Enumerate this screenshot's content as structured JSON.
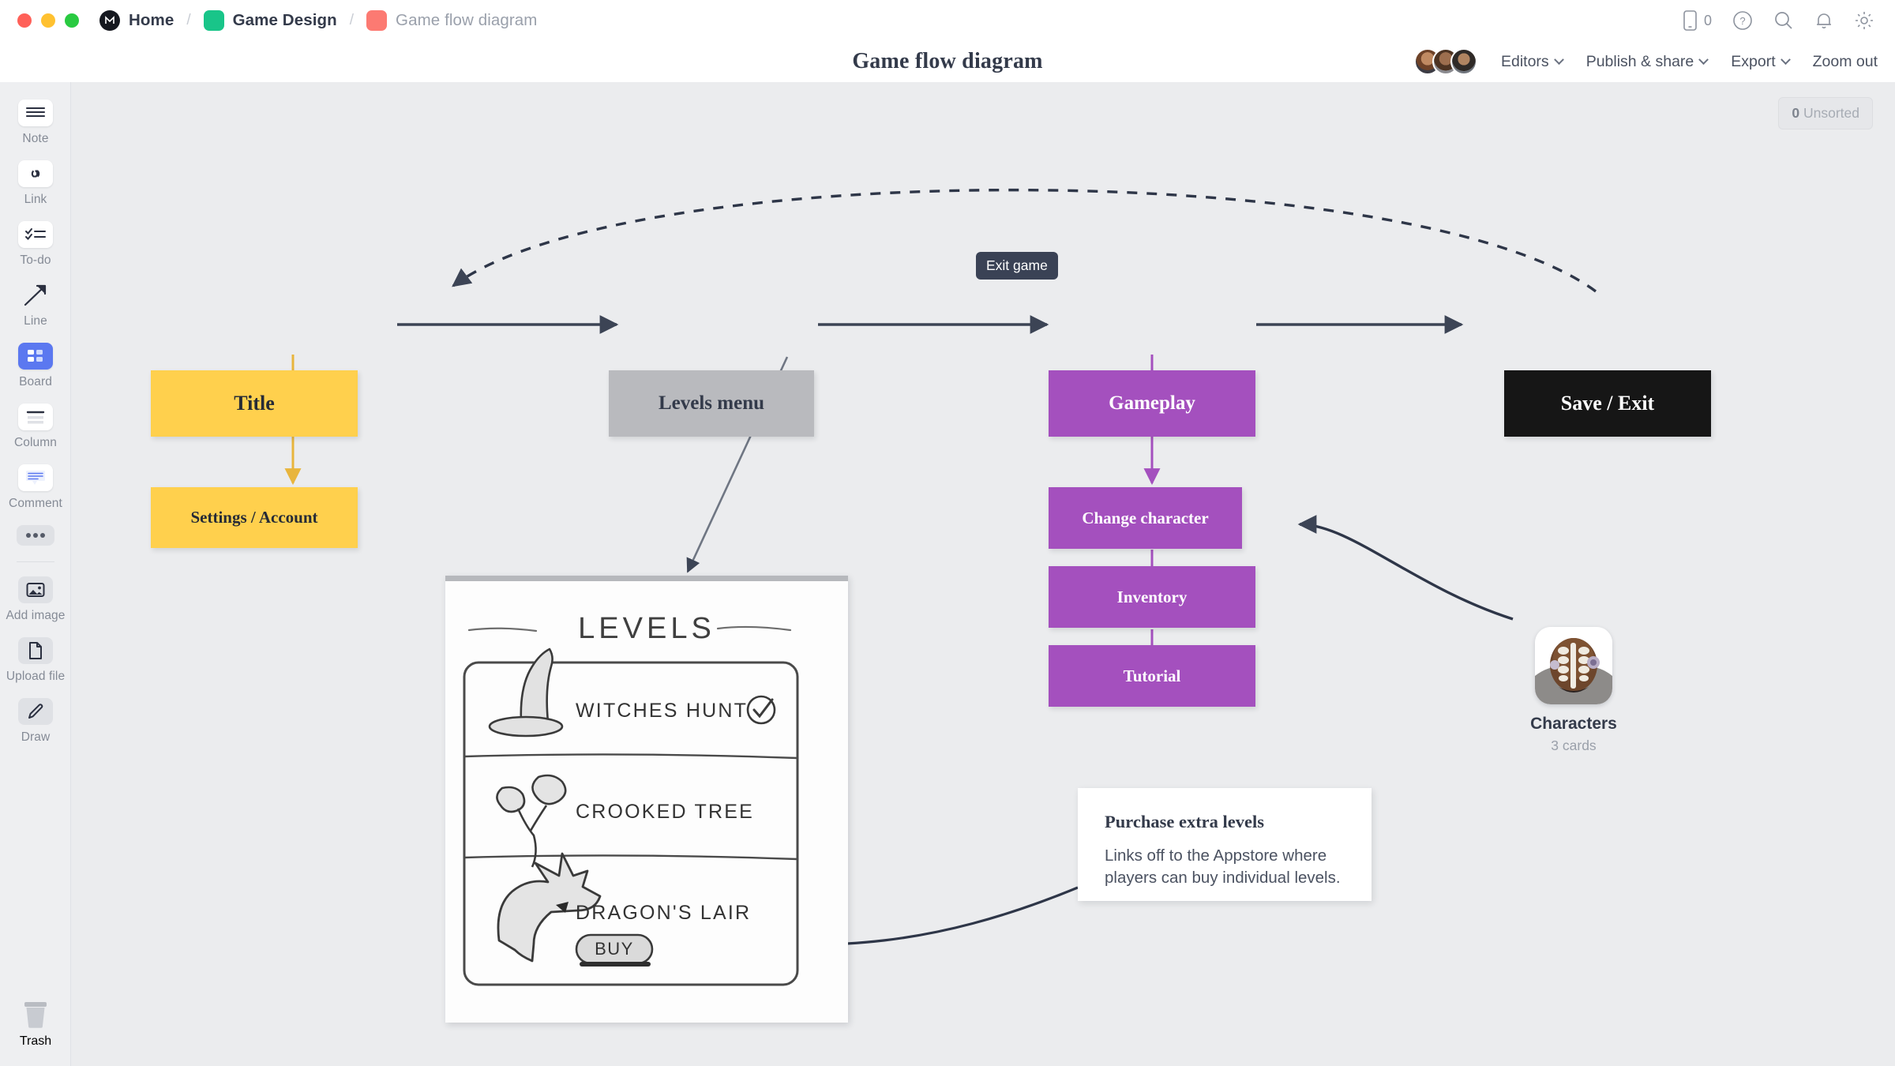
{
  "window": {
    "traffic_lights": [
      "close",
      "minimize",
      "maximize"
    ]
  },
  "breadcrumb": {
    "items": [
      {
        "label": "Home",
        "icon": "milanote-logo-icon",
        "swatch": "#15181f"
      },
      {
        "label": "Game Design",
        "icon": "folder-swatch-icon",
        "swatch": "#19c589"
      },
      {
        "label": "Game flow diagram",
        "icon": "board-swatch-icon",
        "swatch": "#fc7a72"
      }
    ],
    "separator": "/"
  },
  "topbar": {
    "device_count": "0",
    "icons": [
      "mobile-icon",
      "help-icon",
      "search-icon",
      "notifications-icon",
      "settings-icon"
    ]
  },
  "header": {
    "title": "Game flow diagram",
    "menus": [
      {
        "label": "Editors",
        "has_chevron": true
      },
      {
        "label": "Publish & share",
        "has_chevron": true
      },
      {
        "label": "Export",
        "has_chevron": true
      },
      {
        "label": "Zoom out",
        "has_chevron": false
      }
    ],
    "editor_avatars": 3
  },
  "sidebar": {
    "items": [
      {
        "label": "Note",
        "icon": "note-icon",
        "state": "default"
      },
      {
        "label": "Link",
        "icon": "link-icon",
        "state": "default"
      },
      {
        "label": "To-do",
        "icon": "todo-icon",
        "state": "default"
      },
      {
        "label": "Line",
        "icon": "line-arrow-icon",
        "state": "plain"
      },
      {
        "label": "Board",
        "icon": "board-icon",
        "state": "active"
      },
      {
        "label": "Column",
        "icon": "column-icon",
        "state": "default"
      },
      {
        "label": "Comment",
        "icon": "comment-icon",
        "state": "default"
      },
      {
        "label": "",
        "icon": "more-dots-icon",
        "state": "grey"
      },
      {
        "label": "Add image",
        "icon": "add-image-icon",
        "state": "grey"
      },
      {
        "label": "Upload file",
        "icon": "upload-file-icon",
        "state": "grey"
      },
      {
        "label": "Draw",
        "icon": "draw-pencil-icon",
        "state": "grey"
      }
    ],
    "trash": {
      "label": "Trash",
      "icon": "trash-icon"
    }
  },
  "canvas": {
    "unsorted_badge": {
      "count": "0",
      "label": "Unsorted"
    },
    "edge_label": "Exit game",
    "nodes": [
      {
        "id": "title",
        "label": "Title",
        "color": "#ffd04d",
        "text_color": "#262b36"
      },
      {
        "id": "settings",
        "label": "Settings / Account",
        "color": "#ffd04d",
        "text_color": "#262b36"
      },
      {
        "id": "levels",
        "label": "Levels menu",
        "color": "#b9babe",
        "text_color": "#333a4a"
      },
      {
        "id": "gameplay",
        "label": "Gameplay",
        "color": "#a450be",
        "text_color": "#ffffff"
      },
      {
        "id": "saveexit",
        "label": "Save / Exit",
        "color": "#161616",
        "text_color": "#ffffff"
      },
      {
        "id": "change",
        "label": "Change character",
        "color": "#a450be",
        "text_color": "#ffffff"
      },
      {
        "id": "inventory",
        "label": "Inventory",
        "color": "#a450be",
        "text_color": "#ffffff"
      },
      {
        "id": "tutorial",
        "label": "Tutorial",
        "color": "#a450be",
        "text_color": "#ffffff"
      }
    ],
    "sketch": {
      "heading": "LEVELS",
      "rows": [
        {
          "title": "WITCHES HUNT",
          "icon": "witch-hat-sketch-icon",
          "badge": "check-circle-sketch-icon"
        },
        {
          "title": "CROOKED TREE",
          "icon": "crooked-tree-sketch-icon",
          "badge": ""
        },
        {
          "title": "DRAGON'S LAIR",
          "icon": "dragon-sketch-icon",
          "badge": "",
          "button": "BUY"
        }
      ]
    },
    "characters_card": {
      "title": "Characters",
      "subtitle": "3 cards",
      "thumbnail": "creature-face-thumbnail"
    },
    "note_card": {
      "heading": "Purchase extra levels",
      "body": "Links off to the Appstore where players can buy individual levels."
    }
  }
}
